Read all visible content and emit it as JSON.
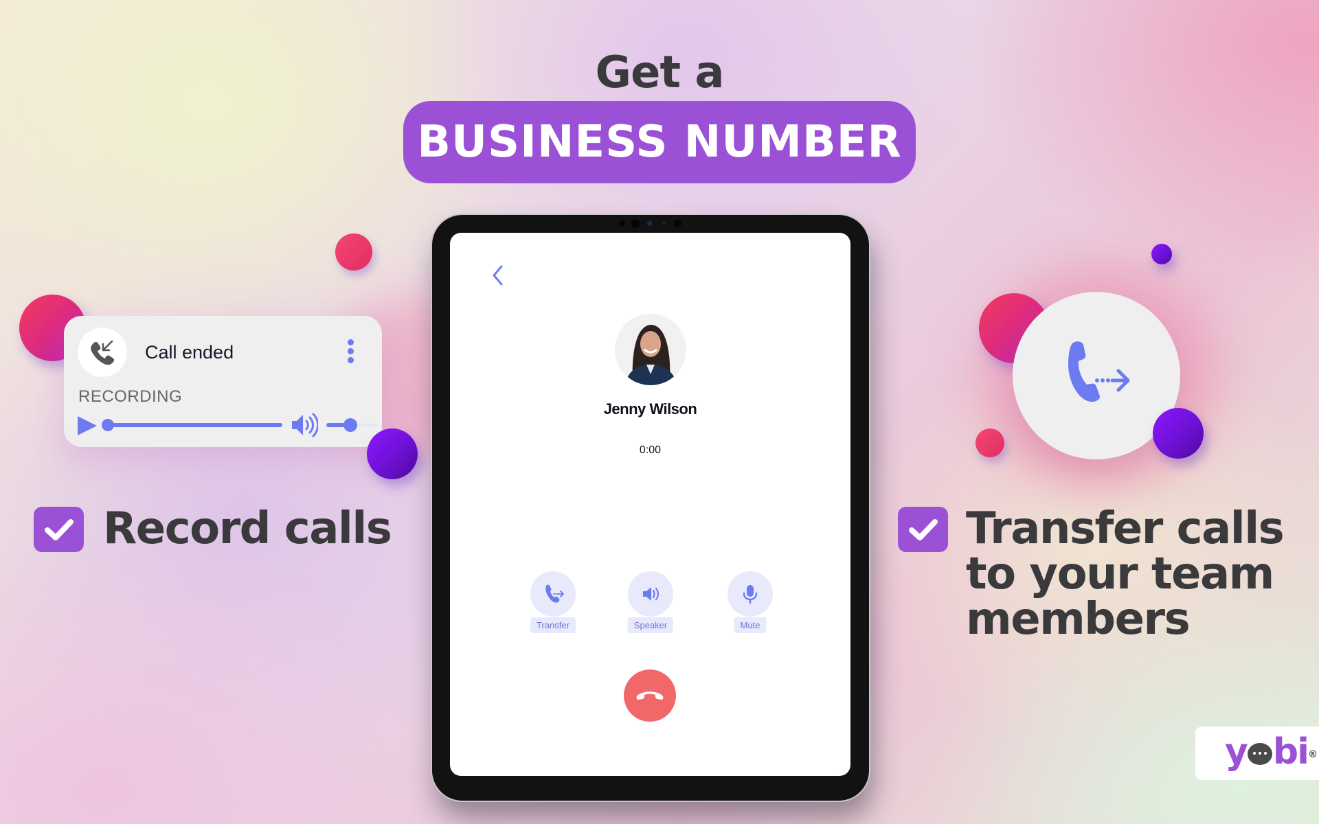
{
  "headline": {
    "line1": "Get a",
    "highlight": "BUSINESS NUMBER"
  },
  "recording_card": {
    "status": "Call ended",
    "section_label": "RECORDING",
    "icons": {
      "call_type": "incoming-call-icon",
      "menu": "more-vertical-icon",
      "play": "play-icon",
      "volume": "volume-icon"
    },
    "playback_progress": 0.0,
    "volume_level": 0.55
  },
  "features": [
    {
      "label": "Record calls",
      "checked": true
    },
    {
      "label_lines": [
        "Transfer calls",
        "to your team",
        "members"
      ],
      "checked": true
    }
  ],
  "call_screen": {
    "back_icon": "chevron-left-icon",
    "caller_name": "Jenny Wilson",
    "timer": "0:00",
    "controls": [
      {
        "label": "Transfer",
        "icon": "call-transfer-icon"
      },
      {
        "label": "Speaker",
        "icon": "speaker-icon"
      },
      {
        "label": "Mute",
        "icon": "microphone-icon"
      }
    ],
    "end_call_icon": "hang-up-icon"
  },
  "transfer_badge": {
    "icon": "call-transfer-icon"
  },
  "logo": {
    "text_left": "y",
    "text_right": "bi",
    "trademark": "®"
  },
  "colors": {
    "accent_purple": "#9b51d6",
    "icon_blue": "#6c7cf0",
    "end_call_red": "#f26767",
    "text_dark": "#3a3a3c"
  }
}
